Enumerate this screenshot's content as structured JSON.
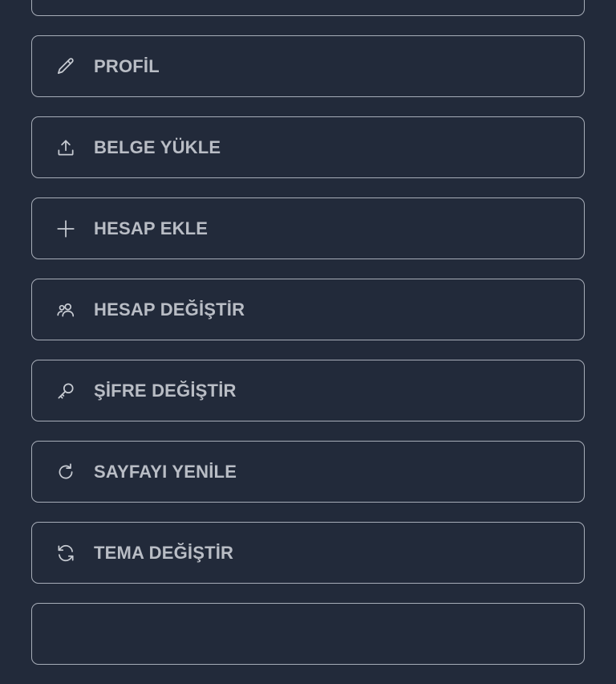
{
  "menu": {
    "items": [
      {
        "label": "",
        "icon": ""
      },
      {
        "label": "PROFİL",
        "icon": "pencil-icon"
      },
      {
        "label": "BELGE YÜKLE",
        "icon": "upload-icon"
      },
      {
        "label": "HESAP EKLE",
        "icon": "plus-icon"
      },
      {
        "label": "HESAP DEĞİŞTİR",
        "icon": "users-icon"
      },
      {
        "label": "ŞİFRE DEĞİŞTİR",
        "icon": "key-icon"
      },
      {
        "label": "SAYFAYI YENİLE",
        "icon": "refresh-icon"
      },
      {
        "label": "TEMA DEĞİŞTİR",
        "icon": "sync-icon"
      },
      {
        "label": "",
        "icon": ""
      }
    ]
  },
  "colors": {
    "background": "#222a3a",
    "border": "#a7adb8",
    "text": "#b9bdc5",
    "icon": "#c7cbd2"
  }
}
